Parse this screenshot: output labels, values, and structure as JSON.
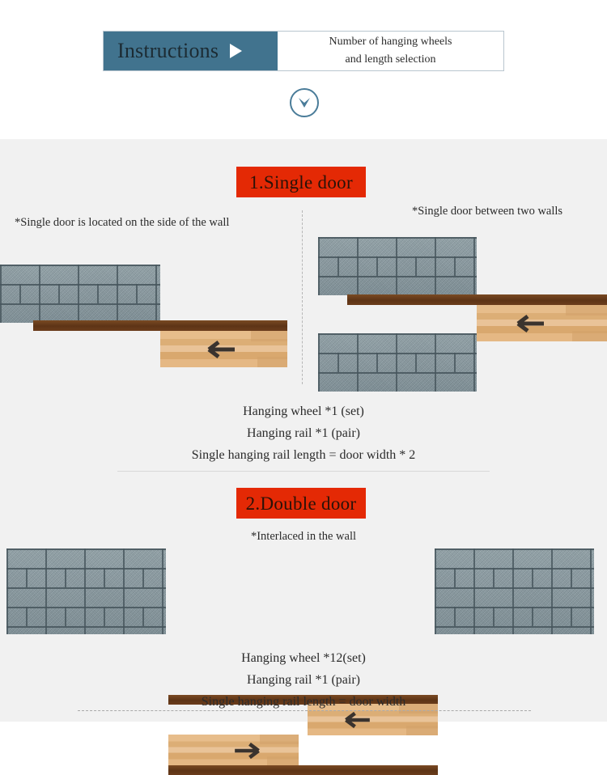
{
  "header": {
    "instructions_label": "Instructions",
    "play_icon": "triangle-right-icon",
    "subtitle_line1": "Number of hanging wheels",
    "subtitle_line2": "and length selection",
    "scroll_icon": "chevron-down-circle-icon",
    "accent_blue": "#41738e"
  },
  "sections": [
    {
      "banner": "1.Single door",
      "banner_color": "#e42905",
      "caption_left": "*Single door is located on the side of the wall",
      "caption_right": "*Single door between two walls",
      "specs": [
        "Hanging wheel *1 (set)",
        "Hanging rail *1 (pair)",
        "Single hanging rail length = door width * 2"
      ],
      "diagram": {
        "left_arrow_icon": "arrow-left-icon",
        "wall_texture": "gray-brick-wall",
        "rail_texture": "brown-hanging-rail",
        "door_texture": "wood-sliding-door"
      }
    },
    {
      "banner": "2.Double door",
      "banner_color": "#e42905",
      "caption_center": "*Interlaced in the wall",
      "specs": [
        "Hanging wheel *12(set)",
        "Hanging rail *1 (pair)",
        "Single hanging rail length = door width"
      ],
      "diagram": {
        "left_arrow_icon": "arrow-left-icon",
        "right_arrow_icon": "arrow-right-icon",
        "wall_texture": "gray-brick-wall",
        "rail_texture": "brown-hanging-rail",
        "door_texture": "wood-sliding-door"
      }
    }
  ],
  "colors": {
    "page_background": "#ffffff",
    "content_background": "#f1f1f1",
    "brick_gray": "#8b9ca3",
    "rail_brown": "#5e3416",
    "wood_tan": "#e0b077",
    "arrow_dark": "#3a332e"
  }
}
